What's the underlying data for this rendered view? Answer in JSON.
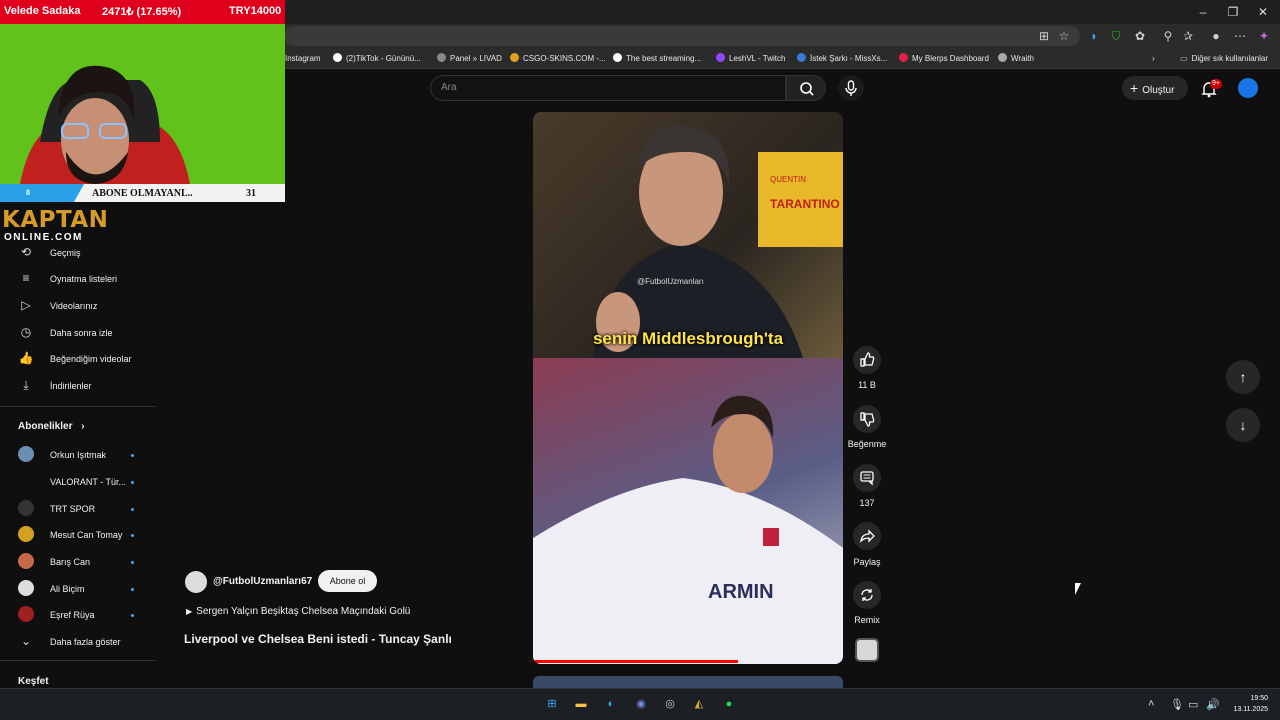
{
  "browser": {
    "bookmarks": [
      {
        "label": "Instagram",
        "color": "#c13584"
      },
      {
        "label": "(2)TikTok - Gününü...",
        "color": "#ffffff"
      },
      {
        "label": "Panel » LIVAD",
        "color": "#888888"
      },
      {
        "label": "CSGO-SKINS.COM -...",
        "color": "#e0a020"
      },
      {
        "label": "The best streaming...",
        "color": "#ffffff"
      },
      {
        "label": "LeshVL - Twitch",
        "color": "#9146ff"
      },
      {
        "label": "İstek Şarkı - MissXs...",
        "color": "#3a7bd5"
      },
      {
        "label": "My Blerps Dashboard",
        "color": "#e0204a"
      },
      {
        "label": "Wraith",
        "color": "#aaaaaa"
      }
    ],
    "other_bookmarks": "Diğer sık kullanılanlar"
  },
  "header": {
    "search_placeholder": "Ara",
    "create_label": "Oluştur",
    "notifications_badge": "9+"
  },
  "overlay": {
    "donation_label": "Velede Sadaka",
    "donation_amount": "2471₺ (17.65%)",
    "donation_goal": "TRY14000",
    "sub_left": "8",
    "sub_label": "ABONE OLMAYANL..",
    "sub_count": "31",
    "logo_top": "KAPTAN",
    "logo_bottom": "ONLINE.COM"
  },
  "sidebar": {
    "items": [
      {
        "label": "Geçmiş",
        "icon": "history-icon",
        "glyph": "⟲"
      },
      {
        "label": "Oynatma listeleri",
        "icon": "playlist-icon",
        "glyph": "≡"
      },
      {
        "label": "Videolarınız",
        "icon": "video-icon",
        "glyph": "▷"
      },
      {
        "label": "Daha sonra izle",
        "icon": "clock-icon",
        "glyph": "◷"
      },
      {
        "label": "Beğendiğim videolar",
        "icon": "thumbs-up-icon",
        "glyph": "👍"
      },
      {
        "label": "İndirilenler",
        "icon": "download-icon",
        "glyph": "⤓"
      }
    ],
    "subs_title": "Abonelikler",
    "subs": [
      {
        "label": "Orkun Işıtmak",
        "color": "#6a8fb0"
      },
      {
        "label": "VALORANT - Tür...",
        "color": "#0f0f0f"
      },
      {
        "label": "TRT SPOR",
        "color": "#333333"
      },
      {
        "label": "Mesut Can Tomay",
        "color": "#d4a020"
      },
      {
        "label": "Barış Can",
        "color": "#c46a4a"
      },
      {
        "label": "Ali Biçim",
        "color": "#dddddd"
      },
      {
        "label": "Eşref Rüya",
        "color": "#a02020"
      }
    ],
    "show_more": "Daha fazla göster",
    "explore": "Keşfet"
  },
  "video": {
    "caption": "senin Middlesbrough'ta",
    "watermark": "@FutbolUzmanları",
    "progress": 0.66
  },
  "actions": {
    "like_count": "11 B",
    "dislike_label": "Beğenme",
    "comments_count": "137",
    "share_label": "Paylaş",
    "remix_label": "Remix"
  },
  "channel": {
    "name": "@FutbolUzmanları67",
    "subscribe_label": "Abone ol",
    "music": "Sergen Yalçın Beşiktaş Chelsea Maçındaki Golü",
    "title": "Liverpool ve Chelsea Beni istedi - Tuncay Şanlı"
  },
  "taskbar": {
    "time": "19:50",
    "date": "13.11.2025"
  }
}
